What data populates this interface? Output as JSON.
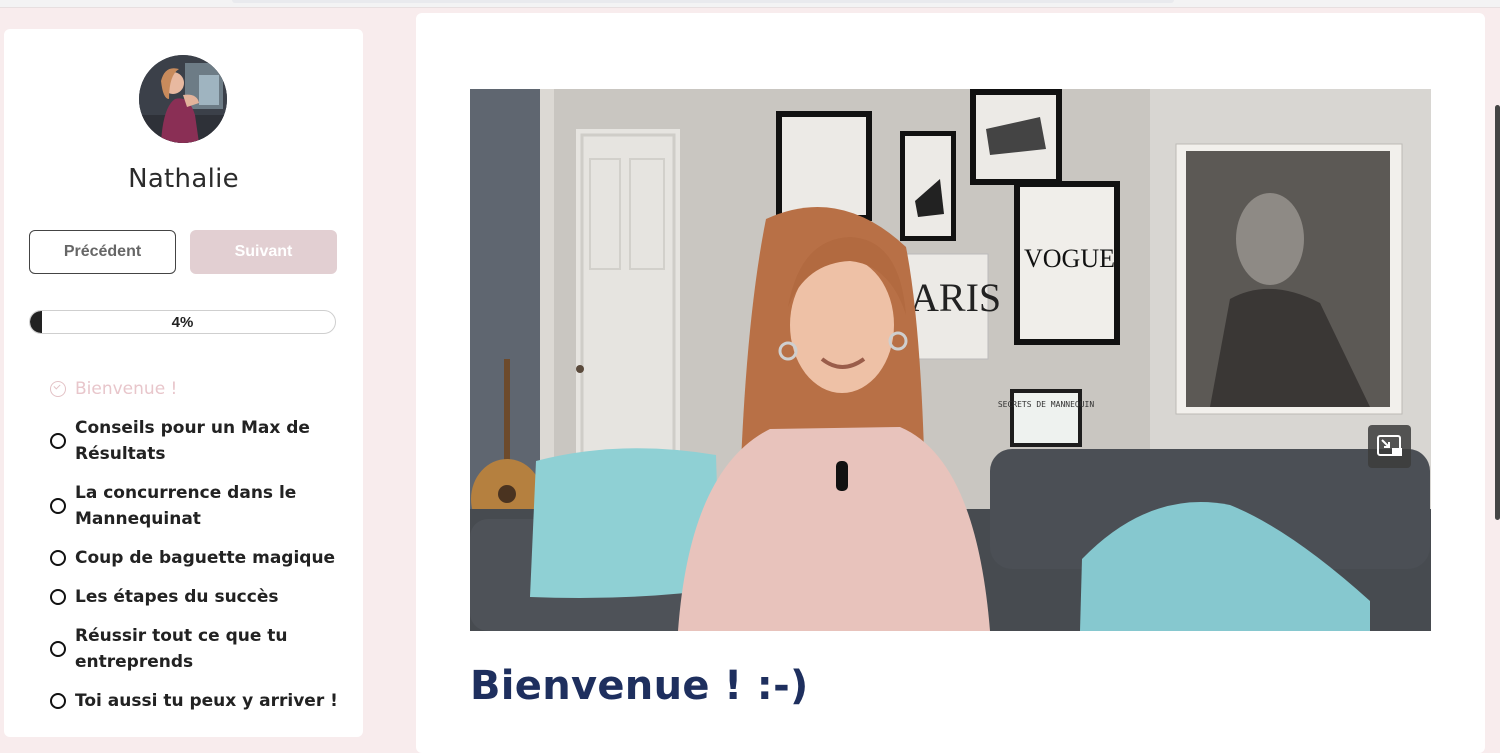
{
  "profile": {
    "name": "Nathalie"
  },
  "navigation": {
    "previous_label": "Précédent",
    "next_label": "Suivant"
  },
  "progress": {
    "value": 0.04,
    "label": "4%"
  },
  "lessons": [
    {
      "title": "Bienvenue !",
      "status": "completed"
    },
    {
      "title": "Conseils pour un Max de Résultats",
      "status": "not-started"
    },
    {
      "title": "La concurrence dans le Mannequinat",
      "status": "not-started"
    },
    {
      "title": "Coup de baguette magique",
      "status": "not-started"
    },
    {
      "title": "Les étapes du succès",
      "status": "not-started"
    },
    {
      "title": "Réussir tout ce que tu entreprends",
      "status": "not-started"
    },
    {
      "title": "Toi aussi tu peux y arriver !",
      "status": "not-started"
    }
  ],
  "content": {
    "title": "Bienvenue ! :-)"
  },
  "video": {
    "wall_art": {
      "vogue": "VOGUE",
      "paris": "ARIS",
      "lightbox": "SECRETS DE MANNEQUIN"
    },
    "controls": {
      "pip_icon": "picture-in-picture-icon"
    }
  },
  "colors": {
    "page_background": "#f8eced",
    "accent_disabled": "#e2cfd2",
    "completed_text": "#e8c6cb",
    "title": "#1e2f5e"
  }
}
